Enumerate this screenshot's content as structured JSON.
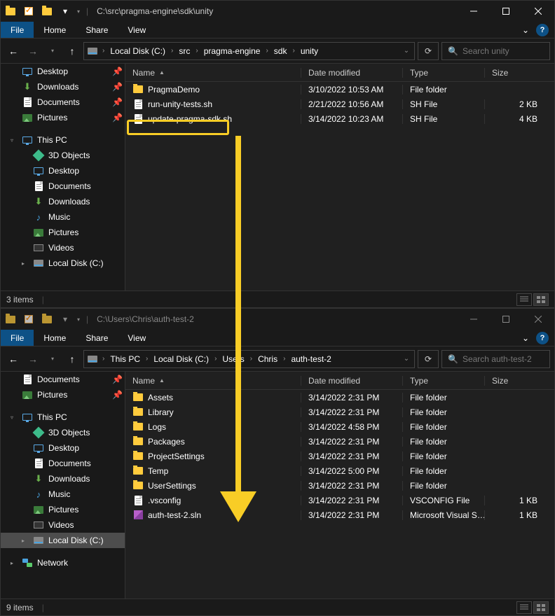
{
  "win1": {
    "title_path": "C:\\src\\pragma-engine\\sdk\\unity",
    "menubar": {
      "file": "File",
      "home": "Home",
      "share": "Share",
      "view": "View"
    },
    "breadcrumb": [
      "Local Disk (C:)",
      "src",
      "pragma-engine",
      "sdk",
      "unity"
    ],
    "search_placeholder": "Search unity",
    "sidebar_quick": [
      {
        "label": "Desktop",
        "pinned": true,
        "icon": "desktop"
      },
      {
        "label": "Downloads",
        "pinned": true,
        "icon": "downloads"
      },
      {
        "label": "Documents",
        "pinned": true,
        "icon": "documents"
      },
      {
        "label": "Pictures",
        "pinned": true,
        "icon": "pictures"
      }
    ],
    "sidebar_thispc_label": "This PC",
    "sidebar_thispc": [
      {
        "label": "3D Objects",
        "icon": "cube"
      },
      {
        "label": "Desktop",
        "icon": "desktop"
      },
      {
        "label": "Documents",
        "icon": "documents"
      },
      {
        "label": "Downloads",
        "icon": "downloads"
      },
      {
        "label": "Music",
        "icon": "music"
      },
      {
        "label": "Pictures",
        "icon": "pictures"
      },
      {
        "label": "Videos",
        "icon": "videos"
      },
      {
        "label": "Local Disk (C:)",
        "icon": "drive",
        "expandable": true
      }
    ],
    "columns": {
      "name": "Name",
      "date": "Date modified",
      "type": "Type",
      "size": "Size"
    },
    "files": [
      {
        "name": "PragmaDemo",
        "date": "3/10/2022 10:53 AM",
        "type": "File folder",
        "size": "",
        "icon": "folder"
      },
      {
        "name": "run-unity-tests.sh",
        "date": "2/21/2022 10:56 AM",
        "type": "SH File",
        "size": "2 KB",
        "icon": "file"
      },
      {
        "name": "update-pragma-sdk.sh",
        "date": "3/14/2022 10:23 AM",
        "type": "SH File",
        "size": "4 KB",
        "icon": "file",
        "highlighted": true
      }
    ],
    "status": "3 items"
  },
  "win2": {
    "title_path": "C:\\Users\\Chris\\auth-test-2",
    "menubar": {
      "file": "File",
      "home": "Home",
      "share": "Share",
      "view": "View"
    },
    "breadcrumb": [
      "This PC",
      "Local Disk (C:)",
      "Users",
      "Chris",
      "auth-test-2"
    ],
    "search_placeholder": "Search auth-test-2",
    "sidebar_top": [
      {
        "label": "Documents",
        "pinned": true,
        "icon": "documents"
      },
      {
        "label": "Pictures",
        "pinned": true,
        "icon": "pictures"
      }
    ],
    "sidebar_thispc_label": "This PC",
    "sidebar_thispc": [
      {
        "label": "3D Objects",
        "icon": "cube"
      },
      {
        "label": "Desktop",
        "icon": "desktop"
      },
      {
        "label": "Documents",
        "icon": "documents"
      },
      {
        "label": "Downloads",
        "icon": "downloads"
      },
      {
        "label": "Music",
        "icon": "music"
      },
      {
        "label": "Pictures",
        "icon": "pictures"
      },
      {
        "label": "Videos",
        "icon": "videos"
      },
      {
        "label": "Local Disk (C:)",
        "icon": "drive",
        "selected": true
      }
    ],
    "sidebar_network_label": "Network",
    "columns": {
      "name": "Name",
      "date": "Date modified",
      "type": "Type",
      "size": "Size"
    },
    "files": [
      {
        "name": "Assets",
        "date": "3/14/2022 2:31 PM",
        "type": "File folder",
        "size": "",
        "icon": "folder"
      },
      {
        "name": "Library",
        "date": "3/14/2022 2:31 PM",
        "type": "File folder",
        "size": "",
        "icon": "folder"
      },
      {
        "name": "Logs",
        "date": "3/14/2022 4:58 PM",
        "type": "File folder",
        "size": "",
        "icon": "folder"
      },
      {
        "name": "Packages",
        "date": "3/14/2022 2:31 PM",
        "type": "File folder",
        "size": "",
        "icon": "folder"
      },
      {
        "name": "ProjectSettings",
        "date": "3/14/2022 2:31 PM",
        "type": "File folder",
        "size": "",
        "icon": "folder"
      },
      {
        "name": "Temp",
        "date": "3/14/2022 5:00 PM",
        "type": "File folder",
        "size": "",
        "icon": "folder"
      },
      {
        "name": "UserSettings",
        "date": "3/14/2022 2:31 PM",
        "type": "File folder",
        "size": "",
        "icon": "folder"
      },
      {
        "name": ".vsconfig",
        "date": "3/14/2022 2:31 PM",
        "type": "VSCONFIG File",
        "size": "1 KB",
        "icon": "file"
      },
      {
        "name": "auth-test-2.sln",
        "date": "3/14/2022 2:31 PM",
        "type": "Microsoft Visual S…",
        "size": "1 KB",
        "icon": "sln"
      }
    ],
    "status": "9 items"
  }
}
